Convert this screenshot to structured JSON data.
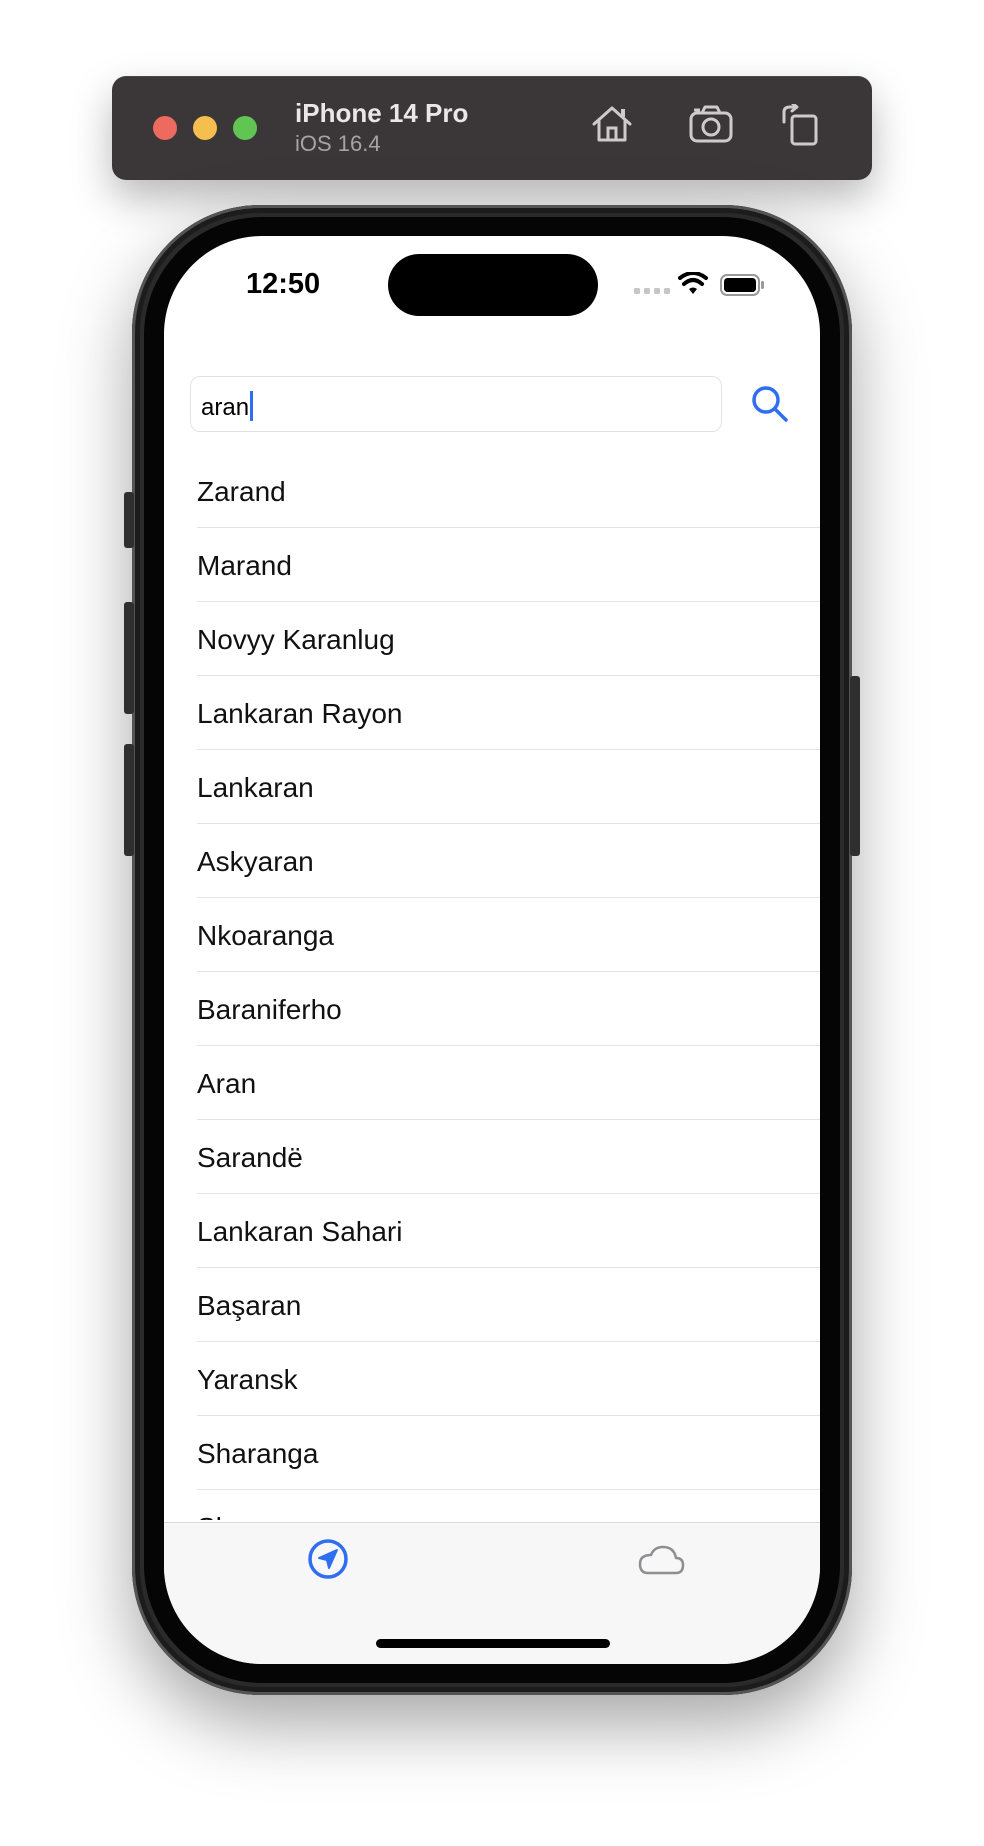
{
  "simulator": {
    "device_name": "iPhone 14 Pro",
    "os_version": "iOS 16.4",
    "icons": [
      "home-icon",
      "screenshot-icon",
      "rotate-icon"
    ]
  },
  "status_bar": {
    "time": "12:50",
    "icons": [
      "cellular-icon",
      "wifi-icon",
      "battery-icon"
    ]
  },
  "search": {
    "value": "aran",
    "button_icon": "search-icon",
    "accent_color": "#2f6ef0"
  },
  "results": [
    "Zarand",
    "Marand",
    "Novyy Karanlug",
    "Lankaran Rayon",
    "Lankaran",
    "Askyaran",
    "Nkoaranga",
    "Baraniferho",
    "Aran",
    "Sarandë",
    "Lankaran Sahari",
    "Başaran",
    "Yaransk",
    "Sharanga",
    "Sharan"
  ],
  "tab_bar": {
    "tabs": [
      {
        "icon": "location-arrow-icon",
        "selected": true,
        "color": "#2f6ef0"
      },
      {
        "icon": "cloud-icon",
        "selected": false,
        "color": "#8e8e93"
      }
    ]
  }
}
